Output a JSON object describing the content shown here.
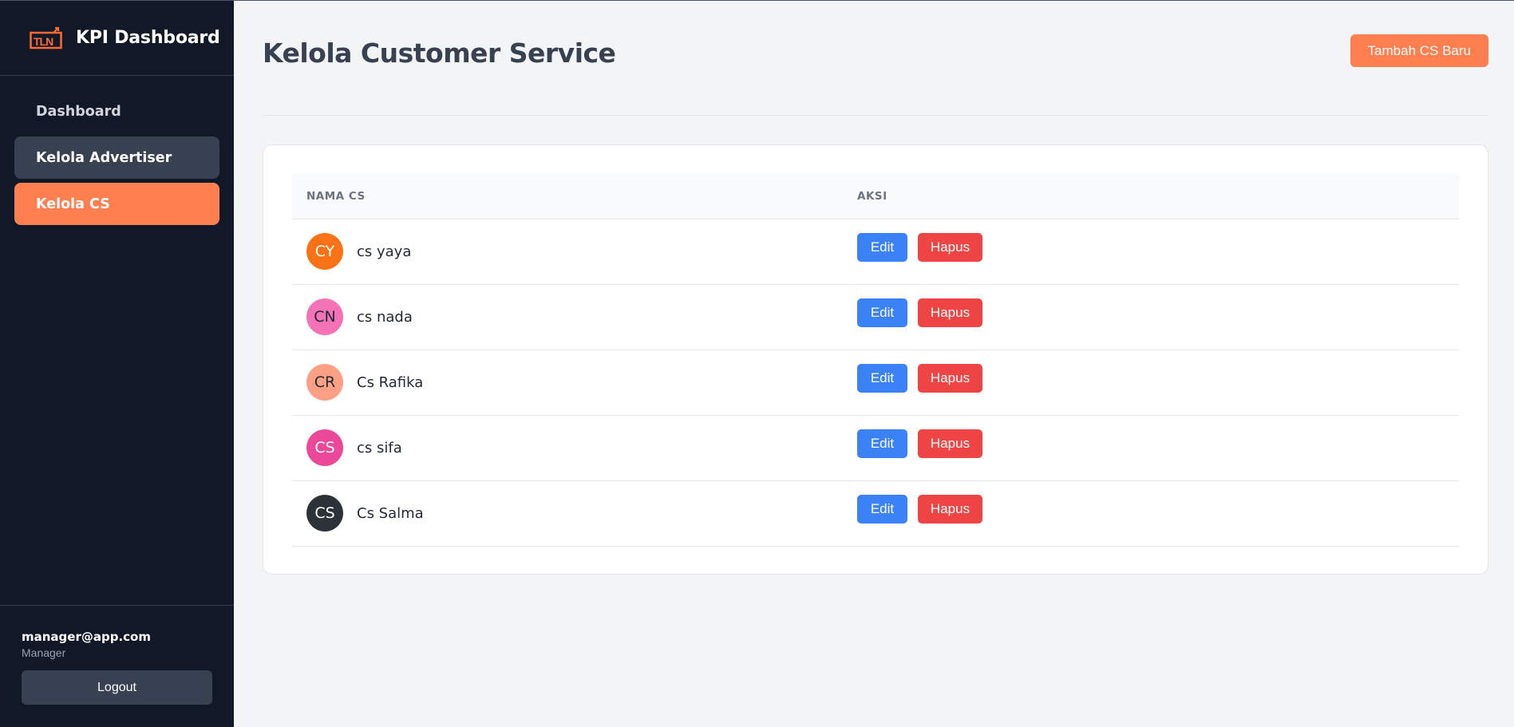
{
  "sidebar": {
    "brand_title": "KPI Dashboard",
    "brand_logo_text": "TLN",
    "nav": [
      {
        "label": "Dashboard"
      },
      {
        "label": "Kelola Advertiser"
      },
      {
        "label": "Kelola CS"
      }
    ],
    "user_email": "manager@app.com",
    "user_role": "Manager",
    "logout_label": "Logout"
  },
  "main": {
    "title": "Kelola Customer Service",
    "add_button_label": "Tambah CS Baru",
    "table": {
      "columns": [
        "NAMA CS",
        "AKSI"
      ],
      "rows": [
        {
          "initials": "CY",
          "name": "cs yaya",
          "avatar_color": "#f97316",
          "avatar_text_color": "#ffffff"
        },
        {
          "initials": "CN",
          "name": "cs nada",
          "avatar_color": "#f472b6",
          "avatar_text_color": "#1f2937"
        },
        {
          "initials": "CR",
          "name": "Cs Rafika",
          "avatar_color": "#fda085",
          "avatar_text_color": "#1f2937"
        },
        {
          "initials": "CS",
          "name": "cs sifa",
          "avatar_color": "#ec4899",
          "avatar_text_color": "#ffffff"
        },
        {
          "initials": "CS",
          "name": "Cs Salma",
          "avatar_color": "#2d3239",
          "avatar_text_color": "#ffffff"
        }
      ],
      "edit_label": "Edit",
      "delete_label": "Hapus"
    }
  },
  "colors": {
    "sidebar_bg": "#111827",
    "accent": "#ff7f50",
    "edit": "#3b82f6",
    "delete": "#ef4444"
  }
}
